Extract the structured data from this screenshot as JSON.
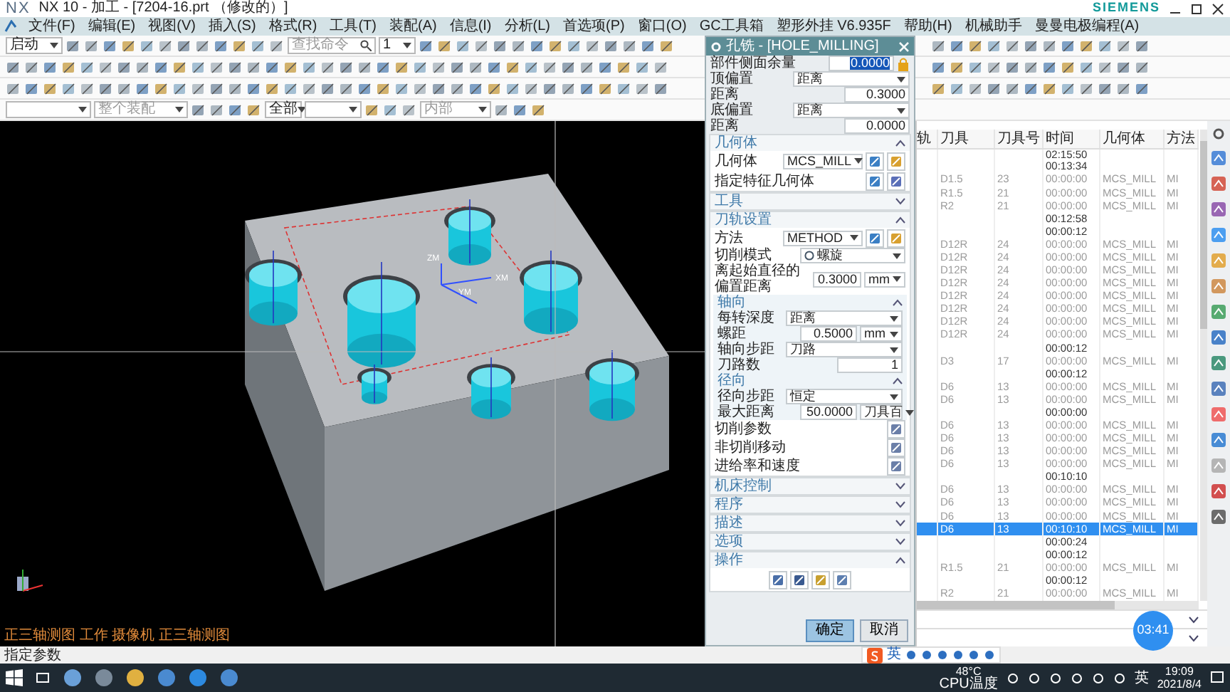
{
  "window": {
    "logo": "NX",
    "title": "NX 10 - 加工 - [7204-16.prt （修改的）]",
    "brand": "SIEMENS"
  },
  "menu": [
    "文件(F)",
    "编辑(E)",
    "视图(V)",
    "插入(S)",
    "格式(R)",
    "工具(T)",
    "装配(A)",
    "信息(I)",
    "分析(L)",
    "首选项(P)",
    "窗口(O)",
    "GC工具箱",
    "塑形外挂 V6.935F",
    "帮助(H)",
    "机械助手",
    "曼曼电极编程(A)"
  ],
  "toolbar": {
    "start_label": "启动",
    "search_placeholder": "查找命令",
    "layer": "1",
    "filter_placeholder": "整个装配",
    "selection": "全部",
    "snap_placeholder": "内部"
  },
  "viewport": {
    "axis_labels": [
      "ZM",
      "YM",
      "XM"
    ],
    "caption": "正三轴测图 工作 摄像机 正三轴测图"
  },
  "dialog": {
    "title": "孔铣 - [HOLE_MILLING]",
    "rows": [
      {
        "kind": "number_lock",
        "label": "部件侧面余量",
        "value": "0.0000",
        "highlighted": true
      },
      {
        "kind": "select",
        "label": "顶偏置",
        "value": "距离"
      },
      {
        "kind": "number",
        "label": "距离",
        "value": "0.3000",
        "highlighted": false
      },
      {
        "kind": "select",
        "label": "底偏置",
        "value": "距离"
      },
      {
        "kind": "number",
        "label": "距离",
        "value": "0.0000",
        "highlighted": false
      }
    ],
    "sections": [
      {
        "title": "几何体",
        "expanded": true,
        "rows": [
          {
            "kind": "select_buttons",
            "label": "几何体",
            "value": "MCS_MILL"
          },
          {
            "kind": "buttons",
            "label": "指定特征几何体"
          }
        ]
      },
      {
        "title": "工具",
        "expanded": false
      },
      {
        "title": "刀轨设置",
        "expanded": true,
        "rows": [
          {
            "kind": "select_buttons",
            "label": "方法",
            "value": "METHOD"
          },
          {
            "kind": "select_icon",
            "label": "切削模式",
            "value": "螺旋"
          },
          {
            "kind": "number_unit",
            "label": "离起始直径的偏置距离",
            "value": "0.3000",
            "unit": "mm"
          },
          {
            "kind": "group",
            "title": "轴向",
            "expanded": true,
            "rows": [
              {
                "kind": "select",
                "label": "每转深度",
                "value": "距离"
              },
              {
                "kind": "number_unit",
                "label": "螺距",
                "value": "0.5000",
                "unit": "mm"
              },
              {
                "kind": "select",
                "label": "轴向步距",
                "value": "刀路"
              },
              {
                "kind": "number",
                "label": "刀路数",
                "value": "1",
                "highlighted": false
              }
            ]
          },
          {
            "kind": "group",
            "title": "径向",
            "expanded": true,
            "rows": [
              {
                "kind": "select",
                "label": "径向步距",
                "value": "恒定"
              },
              {
                "kind": "number_unit",
                "label": "最大距离",
                "value": "50.0000",
                "unit": "刀具百"
              }
            ]
          },
          {
            "kind": "action",
            "label": "切削参数"
          },
          {
            "kind": "action",
            "label": "非切削移动"
          },
          {
            "kind": "action",
            "label": "进给率和速度"
          }
        ]
      },
      {
        "title": "机床控制",
        "expanded": false
      },
      {
        "title": "程序",
        "expanded": false
      },
      {
        "title": "描述",
        "expanded": false
      },
      {
        "title": "选项",
        "expanded": false
      },
      {
        "title": "操作",
        "expanded": true,
        "rows": [
          {
            "kind": "icon_bar"
          }
        ]
      }
    ],
    "buttons": [
      {
        "label": "确定",
        "default": true
      },
      {
        "label": "取消",
        "default": false
      }
    ]
  },
  "navigator": {
    "columns": [
      "轨",
      "刀具",
      "刀具号",
      "时间",
      "几何体",
      "方法"
    ],
    "rows": [
      {
        "kind": "summary",
        "time": "02:15:50",
        "selected": false
      },
      {
        "kind": "summary",
        "time": "00:13:34",
        "selected": false
      },
      {
        "kind": "operation",
        "tool": "D1.5",
        "number": "23",
        "time": "00:00:00",
        "geometry": "MCS_MILL",
        "method": "MI",
        "selected": false
      },
      {
        "kind": "operation",
        "tool": "R1.5",
        "number": "21",
        "time": "00:00:00",
        "geometry": "MCS_MILL",
        "method": "MI",
        "selected": false
      },
      {
        "kind": "operation",
        "tool": "R2",
        "number": "21",
        "time": "00:00:00",
        "geometry": "MCS_MILL",
        "method": "MI",
        "selected": false
      },
      {
        "kind": "summary",
        "time": "00:12:58",
        "selected": false
      },
      {
        "kind": "summary",
        "time": "00:00:12",
        "selected": false
      },
      {
        "kind": "operation",
        "tool": "D12R",
        "number": "24",
        "time": "00:00:00",
        "geometry": "MCS_MILL",
        "method": "MI",
        "selected": false
      },
      {
        "kind": "operation",
        "tool": "D12R",
        "number": "24",
        "time": "00:00:00",
        "geometry": "MCS_MILL",
        "method": "MI",
        "selected": false
      },
      {
        "kind": "operation",
        "tool": "D12R",
        "number": "24",
        "time": "00:00:00",
        "geometry": "MCS_MILL",
        "method": "MI",
        "selected": false
      },
      {
        "kind": "operation",
        "tool": "D12R",
        "number": "24",
        "time": "00:00:00",
        "geometry": "MCS_MILL",
        "method": "MI",
        "selected": false
      },
      {
        "kind": "operation",
        "tool": "D12R",
        "number": "24",
        "time": "00:00:00",
        "geometry": "MCS_MILL",
        "method": "MI",
        "selected": false
      },
      {
        "kind": "operation",
        "tool": "D12R",
        "number": "24",
        "time": "00:00:00",
        "geometry": "MCS_MILL",
        "method": "MI",
        "selected": false
      },
      {
        "kind": "operation",
        "tool": "D12R",
        "number": "24",
        "time": "00:00:00",
        "geometry": "MCS_MILL",
        "method": "MI",
        "selected": false
      },
      {
        "kind": "operation",
        "tool": "D12R",
        "number": "24",
        "time": "00:00:00",
        "geometry": "MCS_MILL",
        "method": "MI",
        "selected": false
      },
      {
        "kind": "summary",
        "time": "00:00:12",
        "selected": false
      },
      {
        "kind": "operation",
        "tool": "D3",
        "number": "17",
        "time": "00:00:00",
        "geometry": "MCS_MILL",
        "method": "MI",
        "selected": false
      },
      {
        "kind": "summary",
        "time": "00:00:12",
        "selected": false
      },
      {
        "kind": "operation",
        "tool": "D6",
        "number": "13",
        "time": "00:00:00",
        "geometry": "MCS_MILL",
        "method": "MI",
        "selected": false
      },
      {
        "kind": "operation",
        "tool": "D6",
        "number": "13",
        "time": "00:00:00",
        "geometry": "MCS_MILL",
        "method": "MI",
        "selected": false
      },
      {
        "kind": "summary",
        "time": "00:00:00",
        "selected": false
      },
      {
        "kind": "operation",
        "tool": "D6",
        "number": "13",
        "time": "00:00:00",
        "geometry": "MCS_MILL",
        "method": "MI",
        "selected": false
      },
      {
        "kind": "operation",
        "tool": "D6",
        "number": "13",
        "time": "00:00:00",
        "geometry": "MCS_MILL",
        "method": "MI",
        "selected": false
      },
      {
        "kind": "operation",
        "tool": "D6",
        "number": "13",
        "time": "00:00:00",
        "geometry": "MCS_MILL",
        "method": "MI",
        "selected": false
      },
      {
        "kind": "operation",
        "tool": "D6",
        "number": "13",
        "time": "00:00:00",
        "geometry": "MCS_MILL",
        "method": "MI",
        "selected": false
      },
      {
        "kind": "summary",
        "time": "00:10:10",
        "selected": false
      },
      {
        "kind": "operation",
        "tool": "D6",
        "number": "13",
        "time": "00:00:00",
        "geometry": "MCS_MILL",
        "method": "MI",
        "selected": false
      },
      {
        "kind": "operation",
        "tool": "D6",
        "number": "13",
        "time": "00:00:00",
        "geometry": "MCS_MILL",
        "method": "MI",
        "selected": false
      },
      {
        "kind": "operation",
        "tool": "D6",
        "number": "13",
        "time": "00:00:00",
        "geometry": "MCS_MILL",
        "method": "MI",
        "selected": false
      },
      {
        "kind": "operation",
        "tool": "D6",
        "number": "13",
        "time": "00:10:10",
        "geometry": "MCS_MILL",
        "method": "MI",
        "selected": true
      },
      {
        "kind": "summary",
        "time": "00:00:24",
        "selected": false
      },
      {
        "kind": "summary",
        "time": "00:00:12",
        "selected": false
      },
      {
        "kind": "operation",
        "tool": "R1.5",
        "number": "21",
        "time": "00:00:00",
        "geometry": "MCS_MILL",
        "method": "MI",
        "selected": false
      },
      {
        "kind": "summary",
        "time": "00:00:12",
        "selected": false
      },
      {
        "kind": "operation",
        "tool": "R2",
        "number": "21",
        "time": "00:00:00",
        "geometry": "MCS_MILL",
        "method": "MI",
        "selected": false
      }
    ]
  },
  "timer": "03:41",
  "status": "指定参数",
  "ime": {
    "mode": "英"
  },
  "taskbar": {
    "temperature": "48°C",
    "sensor": "CPU温度",
    "input": "英",
    "time": "19:09",
    "date": "2021/8/4"
  }
}
